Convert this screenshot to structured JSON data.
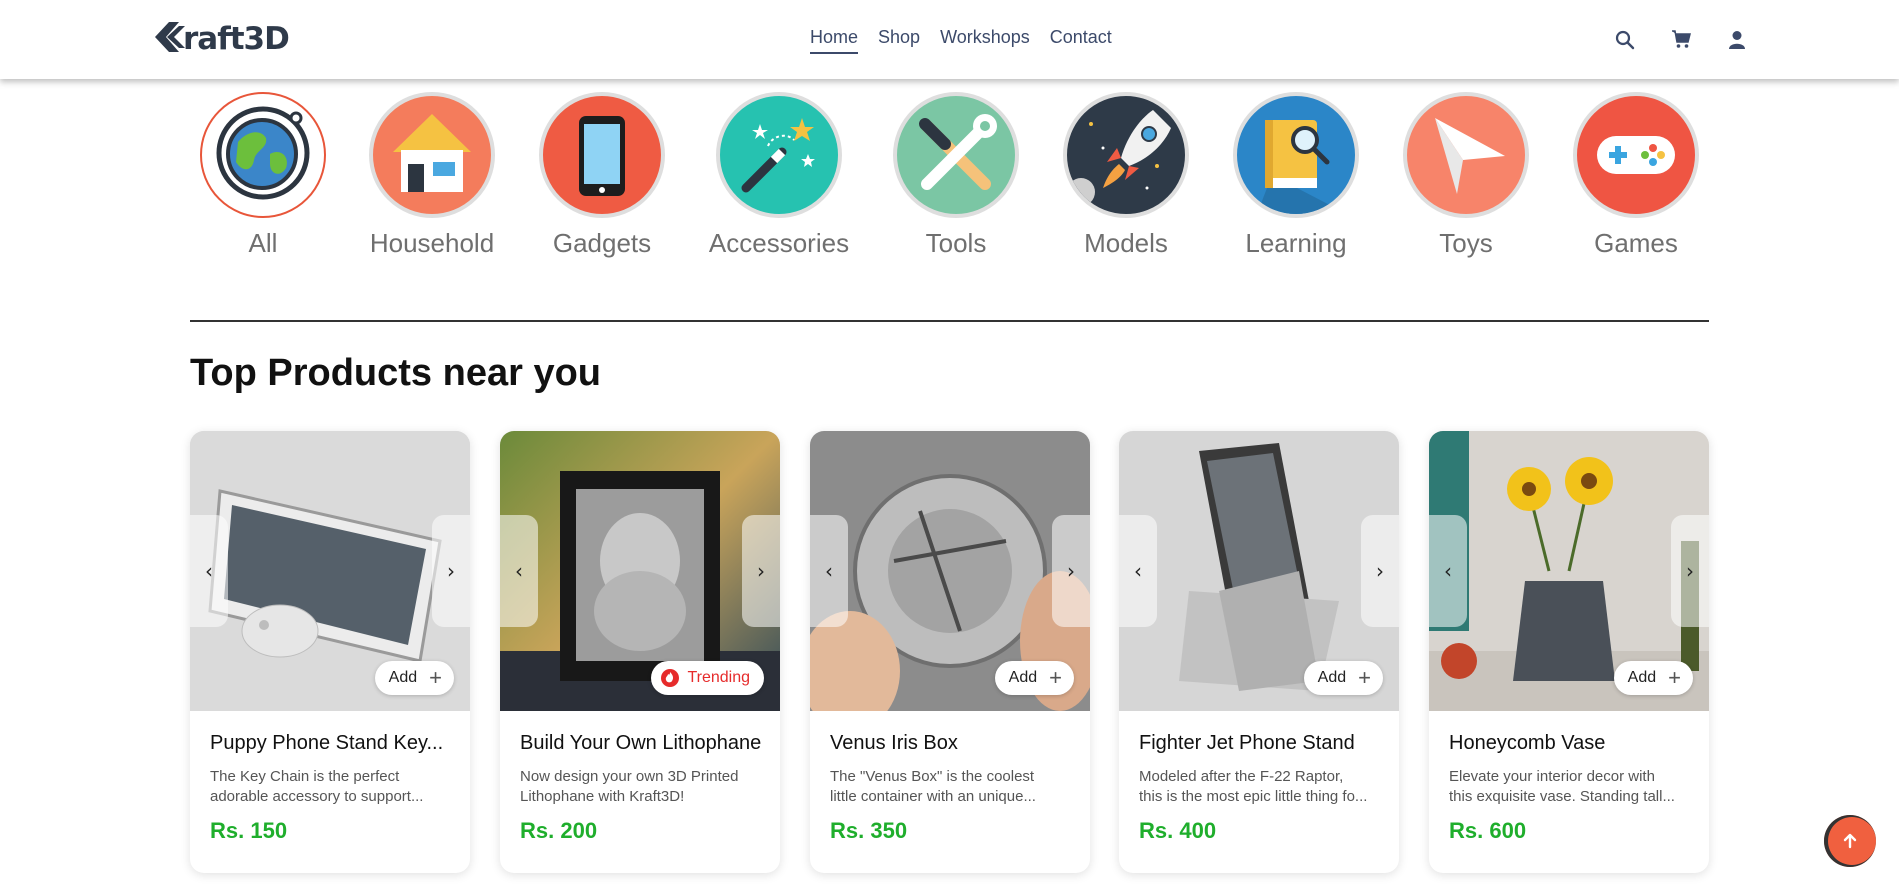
{
  "brand": {
    "name": "Kraft3D"
  },
  "nav": {
    "items": [
      {
        "label": "Home",
        "active": true
      },
      {
        "label": "Shop",
        "active": false
      },
      {
        "label": "Workshops",
        "active": false
      },
      {
        "label": "Contact",
        "active": false
      }
    ]
  },
  "header_icons": [
    "search-icon",
    "cart-icon",
    "user-icon"
  ],
  "categories": [
    {
      "label": "All",
      "icon": "globe-icon",
      "selected": true
    },
    {
      "label": "Household",
      "icon": "house-icon"
    },
    {
      "label": "Gadgets",
      "icon": "phone-icon"
    },
    {
      "label": "Accessories",
      "icon": "magic-wand-icon"
    },
    {
      "label": "Tools",
      "icon": "tools-icon"
    },
    {
      "label": "Models",
      "icon": "rocket-icon"
    },
    {
      "label": "Learning",
      "icon": "book-icon"
    },
    {
      "label": "Toys",
      "icon": "paper-plane-icon"
    },
    {
      "label": "Games",
      "icon": "gamepad-icon"
    }
  ],
  "section": {
    "title": "Top Products near you"
  },
  "products": [
    {
      "title": "Puppy Phone Stand Key...",
      "desc1": "The Key Chain is the perfect",
      "desc2": "adorable accessory to support...",
      "price": "Rs. 150",
      "badge": "Add"
    },
    {
      "title": "Build Your Own Lithophane",
      "desc1": "Now design your own 3D Printed",
      "desc2": "Lithophane with Kraft3D!",
      "price": "Rs. 200",
      "badge": "Trending"
    },
    {
      "title": "Venus Iris Box",
      "desc1": "The \"Venus Box\" is the coolest",
      "desc2": "little container with an unique...",
      "price": "Rs. 350",
      "badge": "Add"
    },
    {
      "title": "Fighter Jet Phone Stand",
      "desc1": "Modeled after the F-22 Raptor,",
      "desc2": "this is the most epic little thing fo...",
      "price": "Rs. 400",
      "badge": "Add"
    },
    {
      "title": "Honeycomb Vase",
      "desc1": "Elevate your interior decor with",
      "desc2": "this exquisite vase. Standing tall...",
      "price": "Rs. 600",
      "badge": "Add"
    }
  ],
  "colors": {
    "accent": "#f0603f",
    "price": "#1fae2c",
    "trending": "#e62b2b",
    "nav": "#3c4a6a"
  }
}
